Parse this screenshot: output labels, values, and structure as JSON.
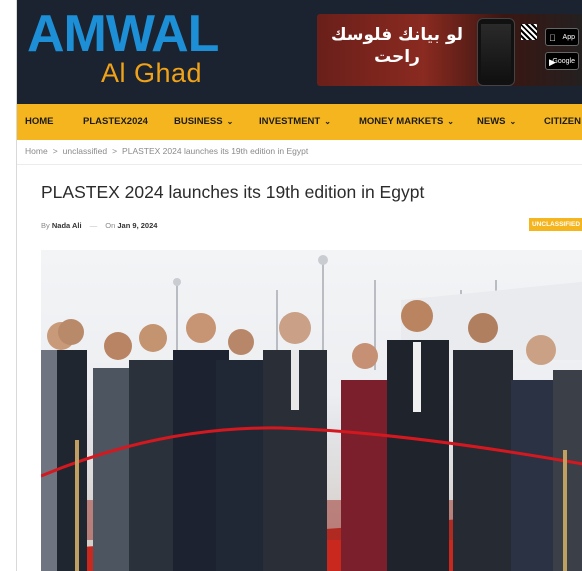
{
  "site": {
    "logo_main": "AMWAL",
    "logo_sub": "Al Ghad"
  },
  "ad": {
    "headline": "لو بيانك فلوسك راحت",
    "store_buttons": [
      {
        "label": "App",
        "icon": "apple-icon"
      },
      {
        "label": "Google",
        "icon": "play-store-icon"
      }
    ]
  },
  "nav": {
    "items": [
      {
        "label": "HOME",
        "has_dropdown": false
      },
      {
        "label": "PLASTEX2024",
        "has_dropdown": false
      },
      {
        "label": "BUSINESS",
        "has_dropdown": true
      },
      {
        "label": "INVESTMENT",
        "has_dropdown": true
      },
      {
        "label": "MONEY MARKETS",
        "has_dropdown": true
      },
      {
        "label": "NEWS",
        "has_dropdown": true
      },
      {
        "label": "CITIZEN A",
        "has_dropdown": false
      }
    ],
    "dropdown_glyph": "⌄"
  },
  "breadcrumb": {
    "items": [
      "Home",
      "unclassified",
      "PLASTEX 2024 launches its 19th edition in Egypt"
    ],
    "separator": ">"
  },
  "article": {
    "title": "PLASTEX 2024 launches its 19th edition in Egypt",
    "by_label": "By",
    "author": "Nada Ali",
    "on_label": "On",
    "date": "Jan 9, 2024",
    "category": "UNCLASSIFIED"
  },
  "colors": {
    "header_bg": "#1b2330",
    "logo_blue": "#1d8fd6",
    "logo_orange": "#f0a218",
    "nav_bg": "#f5b51f",
    "ribbon_red": "#d4181f",
    "carpet_red": "#c8281e"
  }
}
